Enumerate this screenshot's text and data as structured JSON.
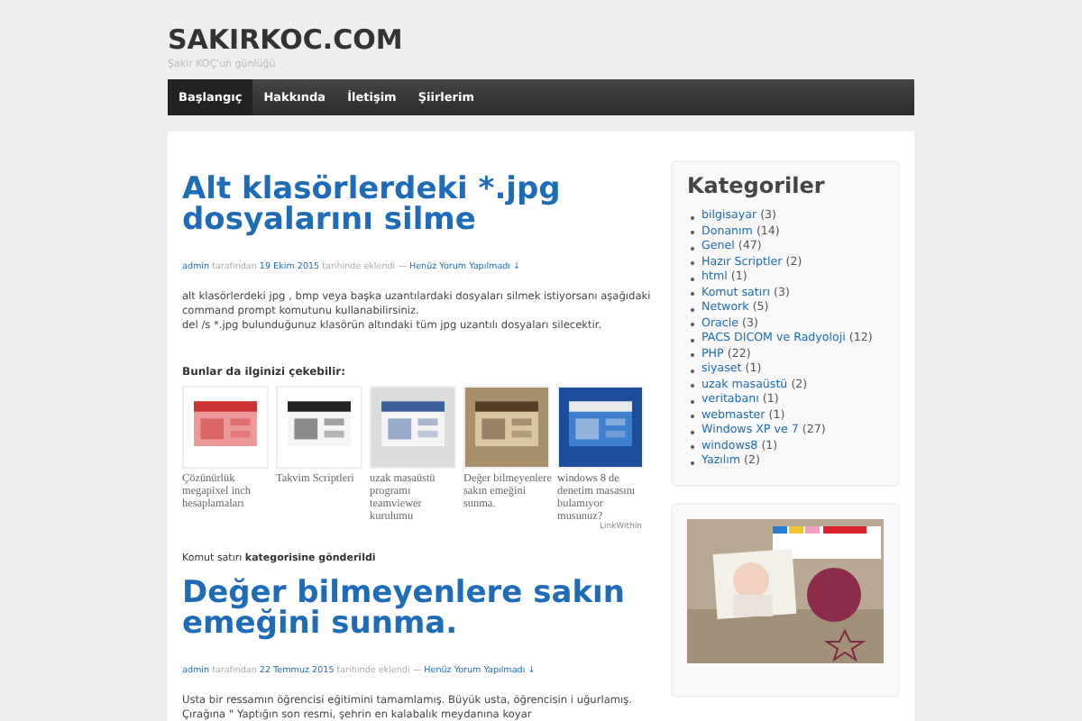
{
  "site": {
    "title": "SAKIRKOC.COM",
    "tagline": "Şakir KOÇ'un günlüğü"
  },
  "nav": [
    {
      "label": "Başlangıç",
      "selected": true
    },
    {
      "label": "Hakkında",
      "selected": false
    },
    {
      "label": "İletişim",
      "selected": false
    },
    {
      "label": "Şiirlerim",
      "selected": false
    }
  ],
  "posts": [
    {
      "title": "Alt klasörlerdeki *.jpg dosyalarını silme",
      "meta": [
        {
          "kind": "link",
          "text": "admin"
        },
        {
          "kind": "text",
          "text": "tarafından"
        },
        {
          "kind": "link",
          "text": "19 Ekim 2015"
        },
        {
          "kind": "text",
          "text": "tarihinde eklendi —"
        },
        {
          "kind": "link",
          "text": "Henüz Yorum Yapılmadı ↓"
        }
      ],
      "body": [
        "alt klasörlerdeki jpg , bmp veya başka uzantılardaki dosyaları silmek istiyorsanı aşağıdaki command prompt komutunu kullanabilirsiniz.",
        "del /s *.jpg bulunduğunuz klasörün altındaki tüm jpg uzantılı dosyaları silecektir."
      ],
      "related": {
        "heading": "Bunlar da ilginizi çekebilir:",
        "items": [
          "Çözünürlük megapixel inch hesaplamaları",
          "Takvim Scriptleri",
          "uzak masaüstü programı teamviewer kurulumu",
          "Değer bilmeyenlere sakın emeğini sunma.",
          "windows 8 de denetim masasını bulamıyor musunuz?"
        ],
        "credit": "LinkWithin"
      },
      "category_note": "Komut satırı **kategorisine gönderildi**"
    },
    {
      "title": "Değer bilmeyenlere sakın emeğini sunma.",
      "meta": [
        {
          "kind": "link",
          "text": "admin"
        },
        {
          "kind": "text",
          "text": "tarafından"
        },
        {
          "kind": "link",
          "text": "22 Temmuz 2015"
        },
        {
          "kind": "text",
          "text": "tarihinde eklendi —"
        },
        {
          "kind": "link",
          "text": "Henüz Yorum Yapılmadı ↓"
        }
      ],
      "body": [
        "Usta bir ressamın öğrencisi eğitimini tamamlamış. Büyük usta, öğrencisin i uğurlamış. Çırağına \" Yaptığın son resmi, şehrin en kalabalık meydanına koyar"
      ]
    }
  ],
  "sidebar": {
    "heading": "Kategoriler",
    "categories": [
      {
        "name": "bilgisayar",
        "count": "(3)"
      },
      {
        "name": "Donanım",
        "count": "(14)"
      },
      {
        "name": "Genel",
        "count": "(47)"
      },
      {
        "name": "Hazır Scriptler",
        "count": "(2)"
      },
      {
        "name": "html",
        "count": "(1)"
      },
      {
        "name": "Komut satırı",
        "count": "(3)"
      },
      {
        "name": "Network",
        "count": "(5)"
      },
      {
        "name": "Oracle",
        "count": "(3)"
      },
      {
        "name": "PACS DICOM ve Radyoloji",
        "count": "(12)"
      },
      {
        "name": "PHP",
        "count": "(22)"
      },
      {
        "name": "siyaset",
        "count": "(1)"
      },
      {
        "name": "uzak masaüstü",
        "count": "(2)"
      },
      {
        "name": "veritabanı",
        "count": "(1)"
      },
      {
        "name": "webmaster",
        "count": "(1)"
      },
      {
        "name": "Windows XP ve 7",
        "count": "(27)"
      },
      {
        "name": "windows8",
        "count": "(1)"
      },
      {
        "name": "Yazılım",
        "count": "(2)"
      }
    ]
  }
}
